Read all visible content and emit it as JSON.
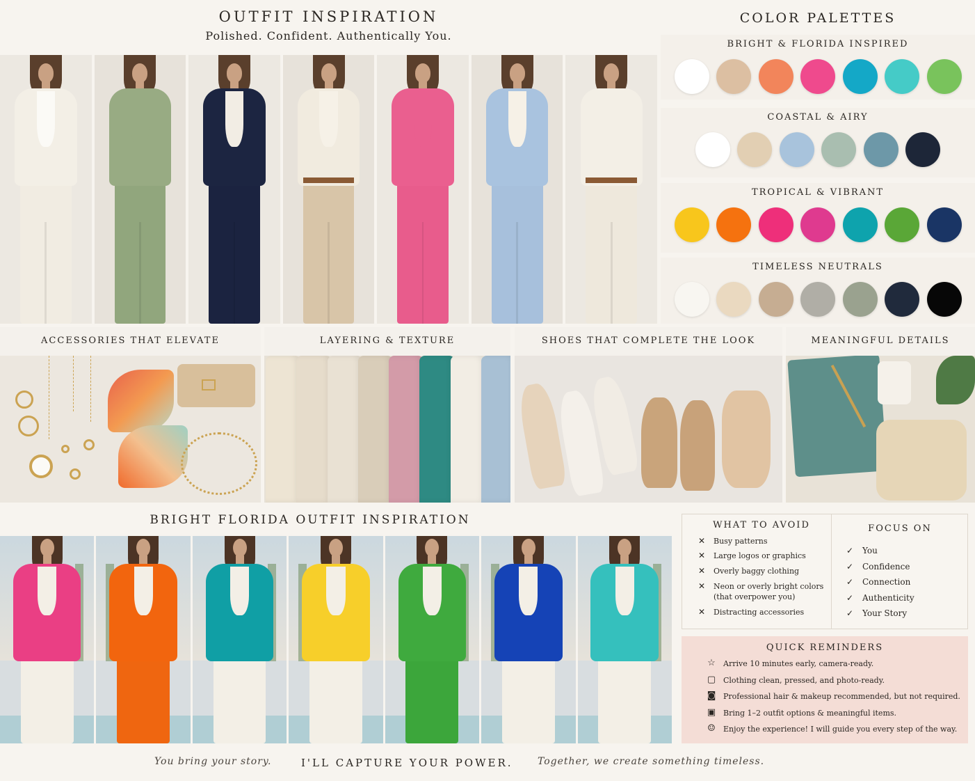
{
  "header": {
    "title": "OUTFIT INSPIRATION",
    "subtitle": "Polished. Confident. Authentically You."
  },
  "top_outfits": [
    {
      "top": "#f3efe6",
      "inner": "#fbfaf6",
      "bottom": "#f1ece2",
      "belt": false
    },
    {
      "top": "#98ab83",
      "inner": "#98ab83",
      "bottom": "#91a67d",
      "belt": false
    },
    {
      "top": "#1c2541",
      "inner": "#f2ede4",
      "bottom": "#1b2340",
      "belt": false
    },
    {
      "top": "#f1ebdf",
      "inner": "#f6f1e7",
      "bottom": "#d8c5a8",
      "belt": true
    },
    {
      "top": "#ea5f8f",
      "inner": "#ea5f8f",
      "bottom": "#e85c8c",
      "belt": false
    },
    {
      "top": "#a9c3df",
      "inner": "#f6f1e7",
      "bottom": "#a7c0dc",
      "belt": false
    },
    {
      "top": "#f3efe6",
      "inner": "#f3efe6",
      "bottom": "#eee8dc",
      "belt": true
    }
  ],
  "palettes": {
    "title": "COLOR PALETTES",
    "groups": [
      {
        "name": "BRIGHT & FLORIDA INSPIRED",
        "colors": [
          "#ffffff",
          "#dcbfa2",
          "#f2855b",
          "#ef4a8d",
          "#14a8c7",
          "#45cbc7",
          "#79c35c"
        ]
      },
      {
        "name": "COASTAL & AIRY",
        "colors": [
          "#ffffff",
          "#e2cfb3",
          "#a8c3dc",
          "#a9beb0",
          "#6d98a8",
          "#1d2638"
        ]
      },
      {
        "name": "TROPICAL & VIBRANT",
        "colors": [
          "#f8c61c",
          "#f5720f",
          "#ee2f7a",
          "#df3a8f",
          "#0ea3ad",
          "#5aa737",
          "#1a3565"
        ]
      },
      {
        "name": "TIMELESS NEUTRALS",
        "colors": [
          "#f8f6f1",
          "#ead9c0",
          "#c6ad92",
          "#b0aea6",
          "#9aa28f",
          "#202a3c",
          "#070707"
        ]
      }
    ]
  },
  "middle": {
    "accessories": "ACCESSORIES THAT ELEVATE",
    "layering": "LAYERING & TEXTURE",
    "shoes": "SHOES THAT COMPLETE THE LOOK",
    "details": "MEANINGFUL DETAILS"
  },
  "fabrics": [
    "#ede4d3",
    "#e6dccb",
    "#e9e1d3",
    "#d9cdb9",
    "#d39ba8",
    "#2e8a83",
    "#f2ede4",
    "#a8c0d4"
  ],
  "bright": {
    "title": "BRIGHT FLORIDA OUTFIT INSPIRATION",
    "outfits": [
      {
        "top": "#ea3f84",
        "bottom": "#f3efe6"
      },
      {
        "top": "#f2650e",
        "bottom": "#ef6610"
      },
      {
        "top": "#109fa5",
        "bottom": "#f3efe6"
      },
      {
        "top": "#f7cf2a",
        "bottom": "#f3efe6"
      },
      {
        "top": "#3faa3e",
        "bottom": "#3ca63b"
      },
      {
        "top": "#1543b6",
        "bottom": "#f3efe6"
      },
      {
        "top": "#35c0bd",
        "bottom": "#f3efe6"
      }
    ]
  },
  "avoid": {
    "title": "WHAT TO AVOID",
    "mark": "✕",
    "items": [
      "Busy patterns",
      "Large logos or graphics",
      "Overly baggy clothing",
      "Neon or overly bright colors (that overpower you)",
      "Distracting accessories"
    ]
  },
  "focus": {
    "title": "FOCUS ON",
    "mark": "✓",
    "items": [
      "You",
      "Confidence",
      "Connection",
      "Authenticity",
      "Your Story"
    ]
  },
  "reminders": {
    "title": "QUICK REMINDERS",
    "items": [
      {
        "icon": "☆",
        "icon_name": "star-icon",
        "text": "Arrive 10 minutes early, camera-ready."
      },
      {
        "icon": "▢",
        "icon_name": "shirt-icon",
        "text": "Clothing clean, pressed, and photo-ready."
      },
      {
        "icon": "◙",
        "icon_name": "mirror-icon",
        "text": "Professional hair & makeup recommended, but not required."
      },
      {
        "icon": "▣",
        "icon_name": "bag-icon",
        "text": "Bring 1–2 outfit options & meaningful items."
      },
      {
        "icon": "☺",
        "icon_name": "smile-icon",
        "text": "Enjoy the experience! I will guide you every step of the way."
      }
    ]
  },
  "footer": {
    "left": "You bring your story.",
    "center": "I'LL CAPTURE YOUR POWER.",
    "right": "Together, we create something timeless."
  }
}
